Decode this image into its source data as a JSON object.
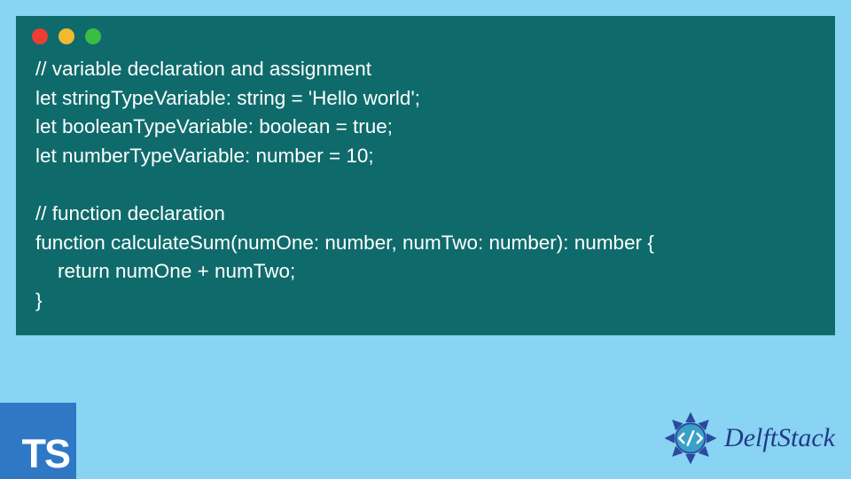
{
  "window": {
    "dots": [
      "red",
      "yellow",
      "green"
    ]
  },
  "code": {
    "line1": "// variable declaration and assignment",
    "line2": "let stringTypeVariable: string = 'Hello world';",
    "line3": "let booleanTypeVariable: boolean = true;",
    "line4": "let numberTypeVariable: number = 10;",
    "line5": "",
    "line6": "// function declaration",
    "line7": "function calculateSum(numOne: number, numTwo: number): number {",
    "line8": "    return numOne + numTwo;",
    "line9": "}"
  },
  "badge": {
    "label": "TS"
  },
  "brand": {
    "name": "DelftStack"
  }
}
